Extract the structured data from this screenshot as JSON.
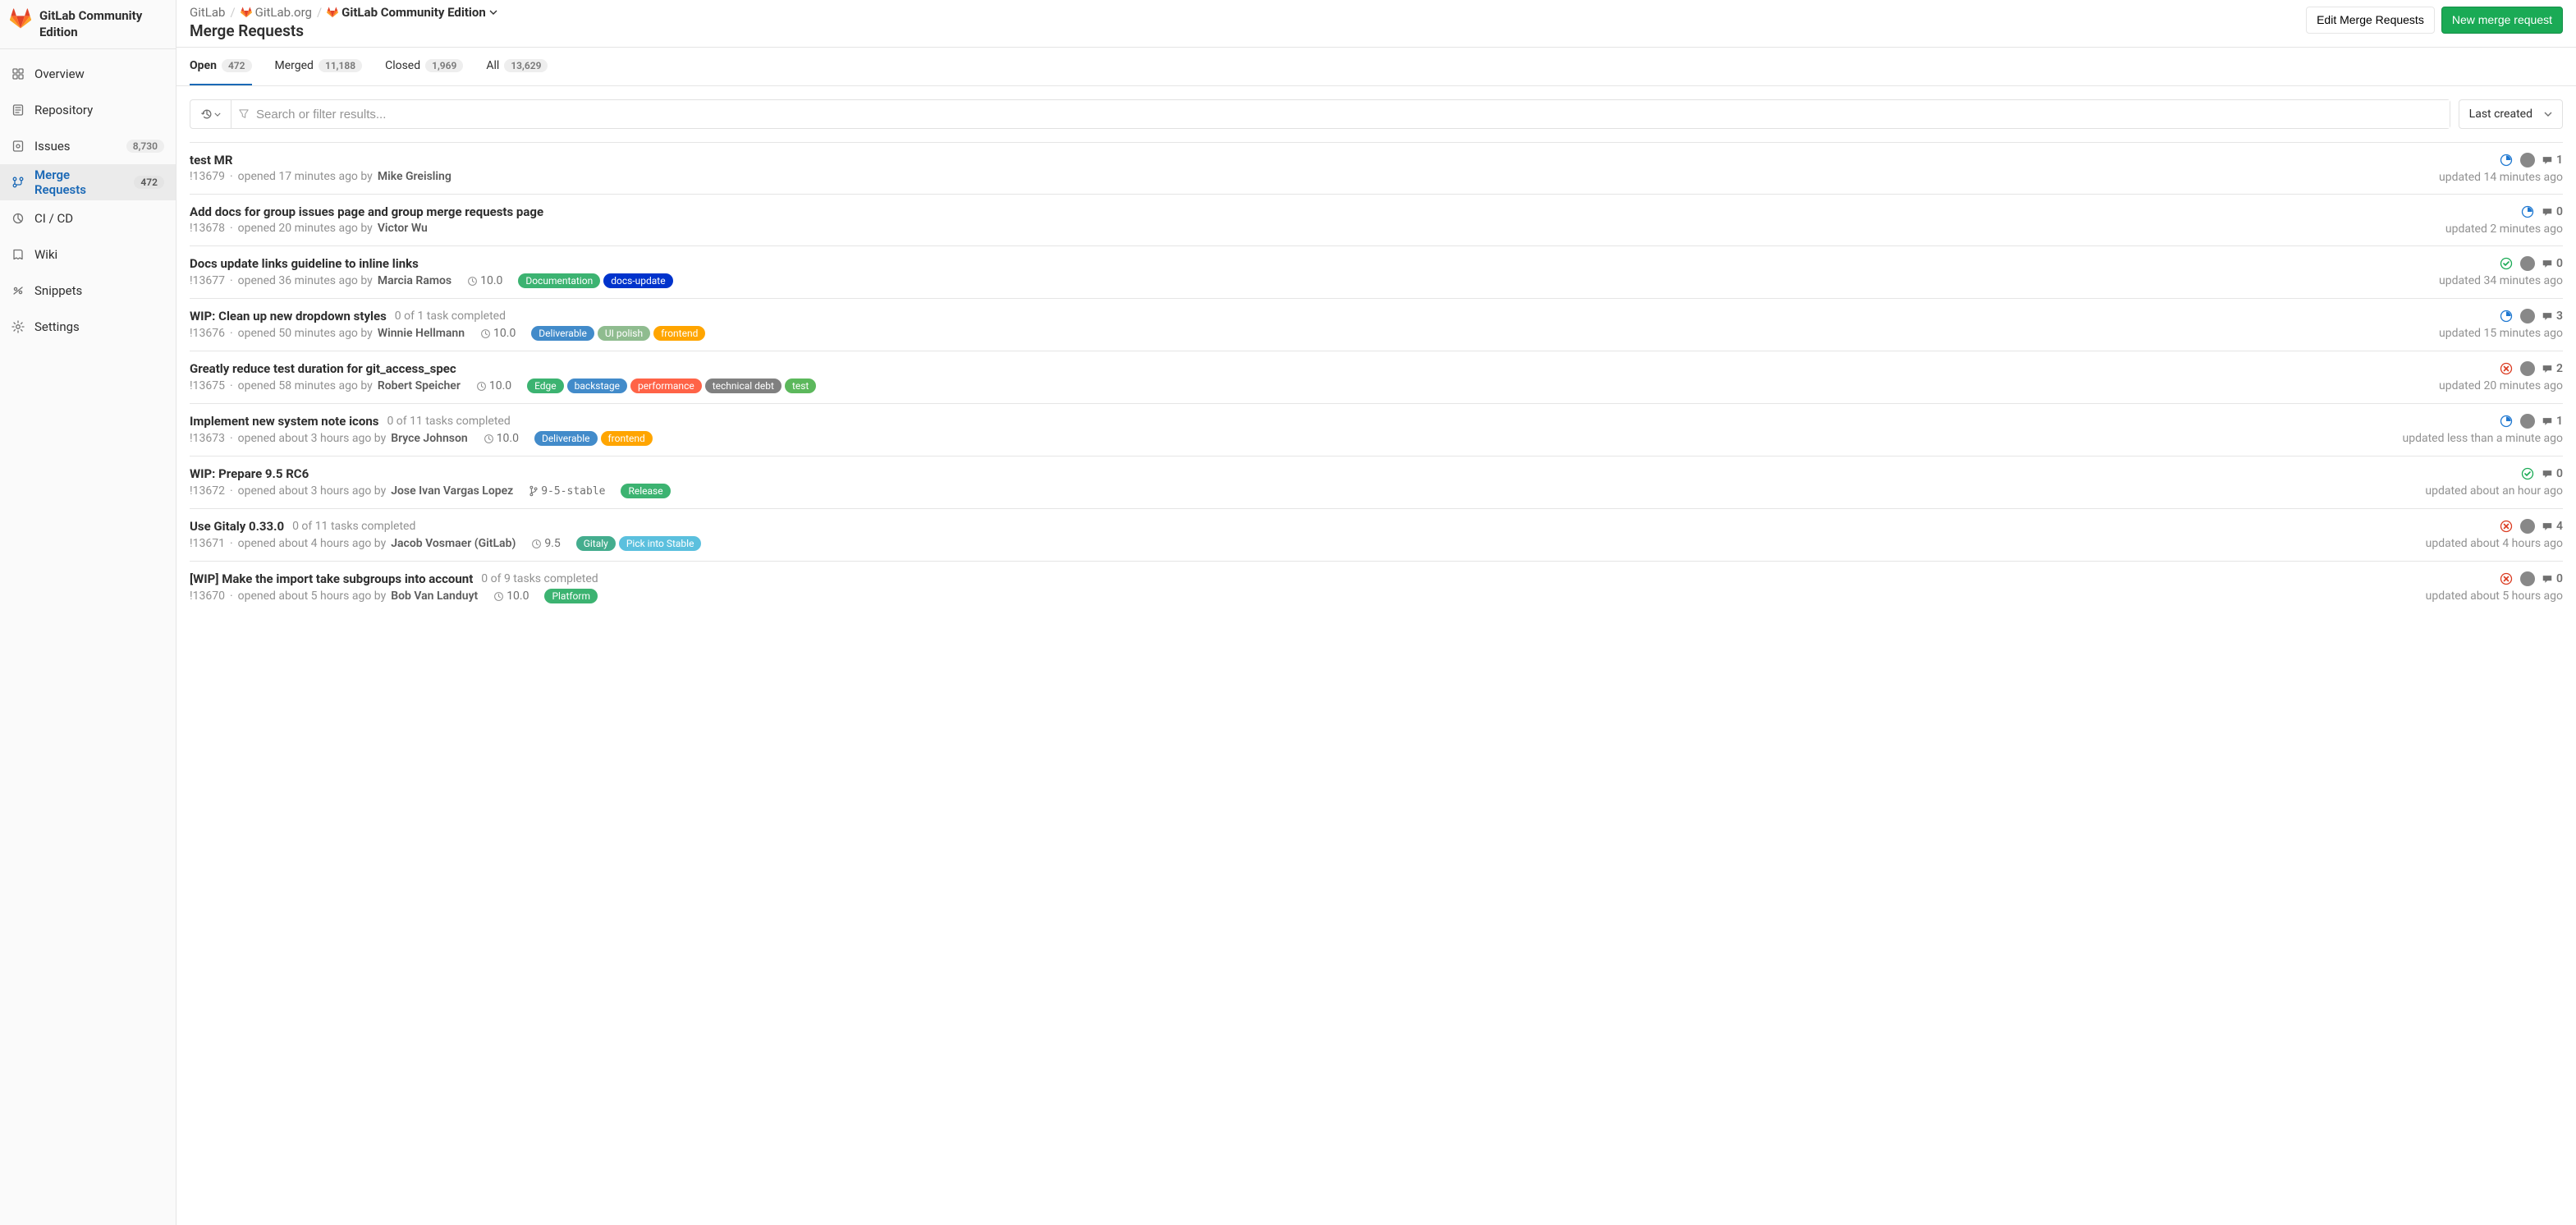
{
  "sidebar": {
    "title": "GitLab Community Edition",
    "items": [
      {
        "label": "Overview"
      },
      {
        "label": "Repository"
      },
      {
        "label": "Issues",
        "badge": "8,730"
      },
      {
        "label": "Merge Requests",
        "badge": "472"
      },
      {
        "label": "CI / CD"
      },
      {
        "label": "Wiki"
      },
      {
        "label": "Snippets"
      },
      {
        "label": "Settings"
      }
    ]
  },
  "breadcrumbs": {
    "root": "GitLab",
    "group": "GitLab.org",
    "project": "GitLab Community Edition"
  },
  "page_title": "Merge Requests",
  "header_actions": {
    "edit": "Edit Merge Requests",
    "new": "New merge request"
  },
  "tabs": [
    {
      "label": "Open",
      "count": "472"
    },
    {
      "label": "Merged",
      "count": "11,188"
    },
    {
      "label": "Closed",
      "count": "1,969"
    },
    {
      "label": "All",
      "count": "13,629"
    }
  ],
  "search": {
    "placeholder": "Search or filter results..."
  },
  "sort": {
    "label": "Last created"
  },
  "label_colors": {
    "Documentation": "#3cb371",
    "docs-update": "#0033cc",
    "Deliverable": "#428bca",
    "UI polish": "#8fbc8f",
    "frontend": "#ffa500",
    "Edge": "#3cb371",
    "backstage": "#428bca",
    "performance": "#ff6347",
    "technical debt": "#808080",
    "test": "#5cb85c",
    "Release": "#3cb371",
    "Gitaly": "#44ad8e",
    "Pick into Stable": "#5bc0de",
    "Platform": "#3cb371"
  },
  "merge_requests": [
    {
      "title": "test MR",
      "ref": "!13679",
      "opened": "opened 17 minutes ago by",
      "author": "Mike Greisling",
      "milestone": null,
      "branch": null,
      "tasks": null,
      "labels": [],
      "ci": "running",
      "assignee": true,
      "comments": "1",
      "updated": "updated 14 minutes ago"
    },
    {
      "title": "Add docs for group issues page and group merge requests page",
      "ref": "!13678",
      "opened": "opened 20 minutes ago by",
      "author": "Victor Wu",
      "milestone": null,
      "branch": null,
      "tasks": null,
      "labels": [],
      "ci": "running",
      "assignee": false,
      "comments": "0",
      "updated": "updated 2 minutes ago"
    },
    {
      "title": "Docs update links guideline to inline links",
      "ref": "!13677",
      "opened": "opened 36 minutes ago by",
      "author": "Marcia Ramos",
      "milestone": "10.0",
      "branch": null,
      "tasks": null,
      "labels": [
        "Documentation",
        "docs-update"
      ],
      "ci": "success",
      "assignee": true,
      "comments": "0",
      "updated": "updated 34 minutes ago"
    },
    {
      "title": "WIP: Clean up new dropdown styles",
      "ref": "!13676",
      "opened": "opened 50 minutes ago by",
      "author": "Winnie Hellmann",
      "milestone": "10.0",
      "branch": null,
      "tasks": "0 of 1 task completed",
      "labels": [
        "Deliverable",
        "UI polish",
        "frontend"
      ],
      "ci": "running",
      "assignee": true,
      "comments": "3",
      "updated": "updated 15 minutes ago"
    },
    {
      "title": "Greatly reduce test duration for git_access_spec",
      "ref": "!13675",
      "opened": "opened 58 minutes ago by",
      "author": "Robert Speicher",
      "milestone": "10.0",
      "branch": null,
      "tasks": null,
      "labels": [
        "Edge",
        "backstage",
        "performance",
        "technical debt",
        "test"
      ],
      "ci": "failed",
      "assignee": true,
      "comments": "2",
      "updated": "updated 20 minutes ago"
    },
    {
      "title": "Implement new system note icons",
      "ref": "!13673",
      "opened": "opened about 3 hours ago by",
      "author": "Bryce Johnson",
      "milestone": "10.0",
      "branch": null,
      "tasks": "0 of 11 tasks completed",
      "labels": [
        "Deliverable",
        "frontend"
      ],
      "ci": "running",
      "assignee": true,
      "comments": "1",
      "updated": "updated less than a minute ago"
    },
    {
      "title": "WIP: Prepare 9.5 RC6",
      "ref": "!13672",
      "opened": "opened about 3 hours ago by",
      "author": "Jose Ivan Vargas Lopez",
      "milestone": null,
      "branch": "9-5-stable",
      "tasks": null,
      "labels": [
        "Release"
      ],
      "ci": "success",
      "assignee": false,
      "comments": "0",
      "updated": "updated about an hour ago"
    },
    {
      "title": "Use Gitaly 0.33.0",
      "ref": "!13671",
      "opened": "opened about 4 hours ago by",
      "author": "Jacob Vosmaer (GitLab)",
      "milestone": "9.5",
      "branch": null,
      "tasks": "0 of 11 tasks completed",
      "labels": [
        "Gitaly",
        "Pick into Stable"
      ],
      "ci": "failed",
      "assignee": true,
      "comments": "4",
      "updated": "updated about 4 hours ago"
    },
    {
      "title": "[WIP] Make the import take subgroups into account",
      "ref": "!13670",
      "opened": "opened about 5 hours ago by",
      "author": "Bob Van Landuyt",
      "milestone": "10.0",
      "branch": null,
      "tasks": "0 of 9 tasks completed",
      "labels": [
        "Platform"
      ],
      "ci": "failed",
      "assignee": true,
      "comments": "0",
      "updated": "updated about 5 hours ago"
    }
  ]
}
